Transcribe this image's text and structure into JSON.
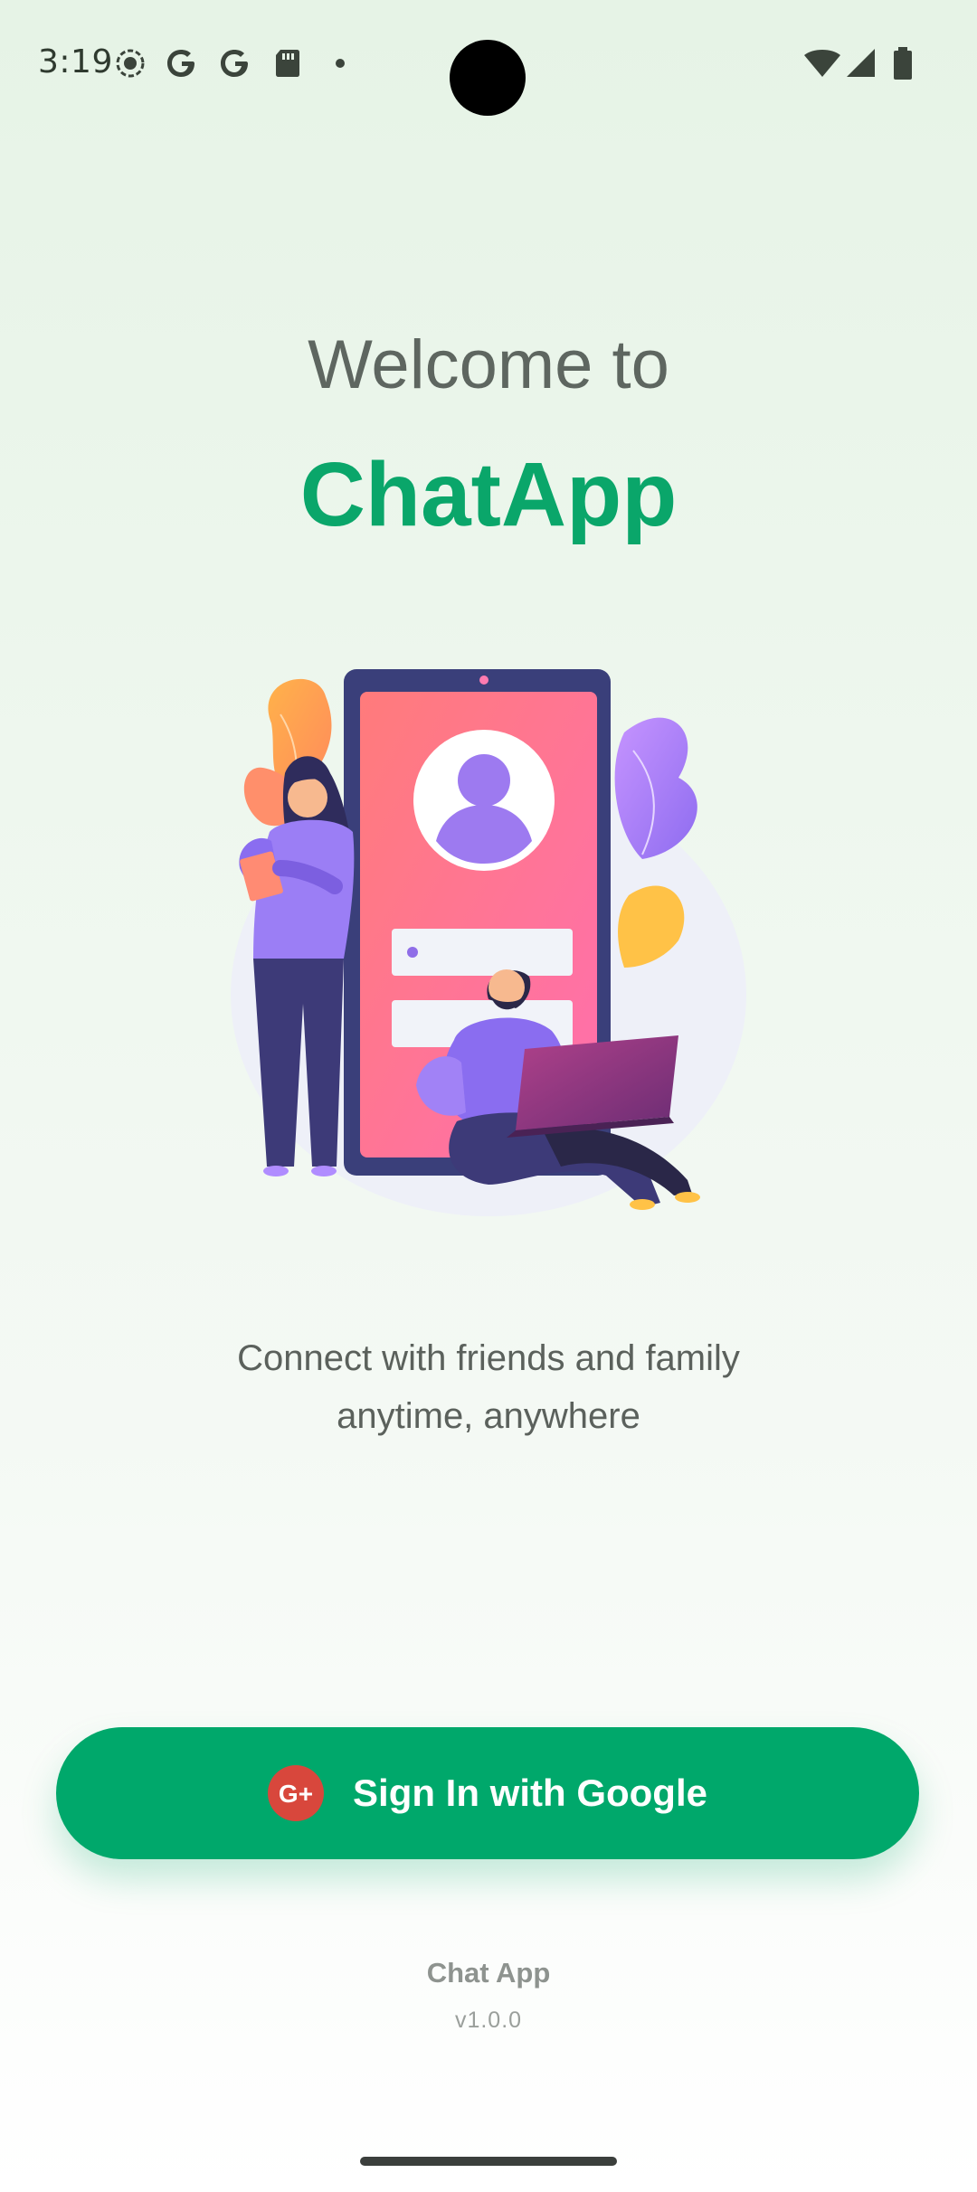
{
  "status_bar": {
    "time": "3:19",
    "icons": [
      "radio-button-icon",
      "google-g-icon",
      "google-g-icon",
      "sd-card-icon",
      "dot-icon",
      "wifi-icon",
      "signal-icon",
      "battery-icon"
    ]
  },
  "welcome": {
    "greeting": "Welcome to",
    "app_name": "ChatApp"
  },
  "illustration": {
    "icon": "login-illustration"
  },
  "tagline": {
    "line1": "Connect with friends and family",
    "line2": "anytime, anywhere"
  },
  "signin": {
    "label": "Sign In with Google",
    "icon": "google-plus-icon",
    "icon_text": "G+"
  },
  "footer": {
    "app": "Chat App",
    "version": "v1.0.0"
  },
  "colors": {
    "brand": "#0aa66a",
    "button": "#00a86b",
    "google_red": "#d8473c"
  }
}
